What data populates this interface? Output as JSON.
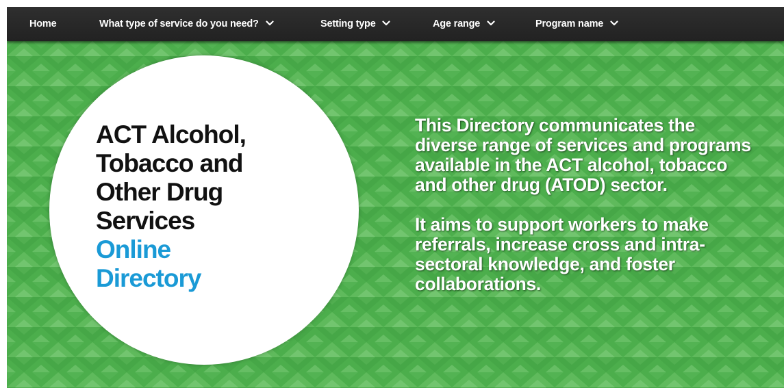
{
  "nav": {
    "home": "Home",
    "service_type": "What type of service do you need?",
    "setting_type": "Setting type",
    "age_range": "Age range",
    "program_name": "Program name"
  },
  "hero": {
    "title_lines": [
      "ACT Alcohol,",
      "Tobacco and",
      "Other Drug",
      "Services"
    ],
    "subtitle_lines": [
      "Online",
      "Directory"
    ],
    "paragraph1": "This Directory communicates the diverse range of services and programs available in the ACT alcohol, tobacco and other drug (ATOD) sector.",
    "paragraph2": "It aims to support workers to make referrals, increase cross and intra-sectoral knowledge, and foster collaborations."
  },
  "colors": {
    "navbar": "#2a2a2a",
    "hero_green": "#4cae4c",
    "title_dark": "#111111",
    "title_blue": "#1a9ad6"
  },
  "icons": [
    "chevron-down-icon"
  ]
}
